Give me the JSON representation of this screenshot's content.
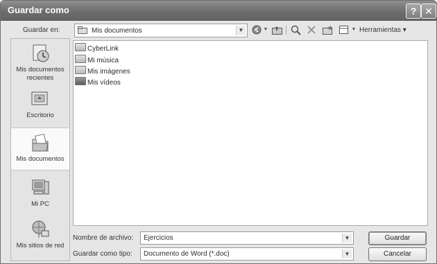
{
  "window": {
    "title": "Guardar como",
    "help_label": "?",
    "close_label": "✕"
  },
  "toolbar": {
    "save_in_label": "Guardar en:",
    "location_value": "Mis documentos",
    "tools_label": "Herramientas",
    "icons": [
      "folder-icon",
      "back-icon",
      "up-folder-icon",
      "search-web-icon",
      "delete-icon",
      "new-folder-icon",
      "views-icon"
    ]
  },
  "places": {
    "items": [
      {
        "label_line1": "Mis documentos",
        "label_line2": "recientes",
        "icon": "recent-documents-icon"
      },
      {
        "label_line1": "Escritorio",
        "label_line2": "",
        "icon": "desktop-icon"
      },
      {
        "label_line1": "Mis documentos",
        "label_line2": "",
        "icon": "my-documents-icon",
        "selected": true
      },
      {
        "label_line1": "Mi PC",
        "label_line2": "",
        "icon": "my-computer-icon"
      },
      {
        "label_line1": "Mis sitios de red",
        "label_line2": "",
        "icon": "network-places-icon"
      }
    ]
  },
  "files": [
    {
      "name": "CyberLink"
    },
    {
      "name": "Mi música"
    },
    {
      "name": "Mis imágenes"
    },
    {
      "name": "Mis vídeos"
    }
  ],
  "bottom": {
    "filename_label": "Nombre de archivo:",
    "filename_value": "Ejercicios",
    "filetype_label": "Guardar como tipo:",
    "filetype_value": "Documento de Word (*.doc)",
    "save_button": "Guardar",
    "cancel_button": "Cancelar"
  }
}
